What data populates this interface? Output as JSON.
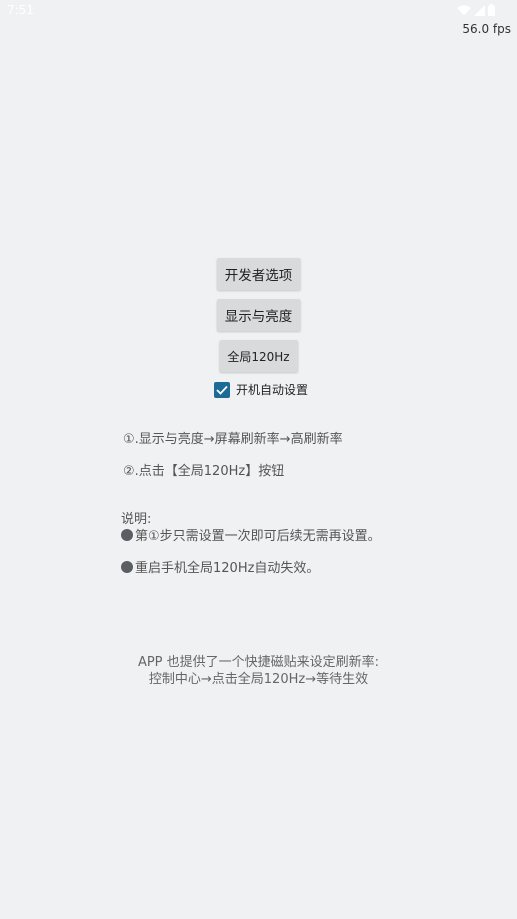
{
  "status_bar": {
    "time": "7:51",
    "icons": [
      "wifi-icon",
      "signal-icon",
      "battery-icon"
    ],
    "icon_color": "#ffffff"
  },
  "fps_counter": "56.0 fps",
  "buttons": {
    "developer_options": "开发者选项",
    "display_brightness": "显示与亮度",
    "global_120hz": "全局120Hz"
  },
  "checkbox": {
    "label": "开机自动设置",
    "checked": true,
    "color": "#1c6b96"
  },
  "steps": [
    "①.显示与亮度→屏幕刷新率→高刷新率",
    "②.点击【全局120Hz】按钮"
  ],
  "notes": {
    "title": "说明:",
    "items": [
      "第①步只需设置一次即可后续无需再设置。",
      "重启手机全局120Hz自动失效。"
    ]
  },
  "tile_info": {
    "line1": "APP 也提供了一个快捷磁贴来设定刷新率:",
    "line2": "控制中心→点击全局120Hz→等待生效"
  },
  "colors": {
    "background": "#eff1f3",
    "button_bg": "#d9dadb"
  }
}
